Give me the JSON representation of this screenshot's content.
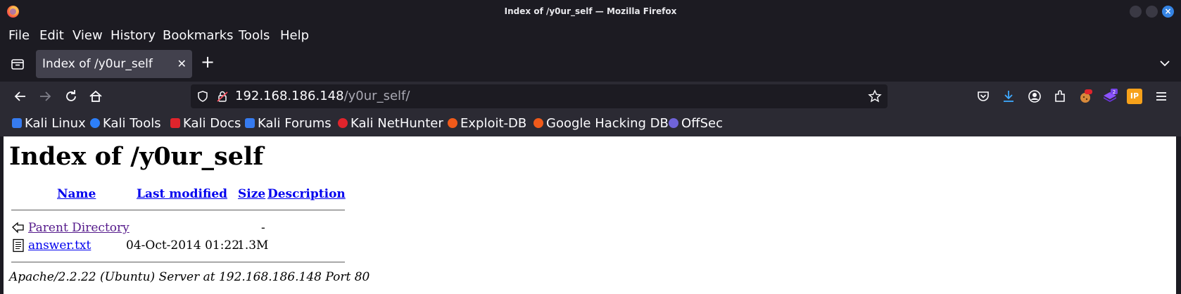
{
  "window": {
    "title": "Index of /y0ur_self — Mozilla Firefox"
  },
  "menu": {
    "items": [
      "File",
      "Edit",
      "View",
      "History",
      "Bookmarks",
      "Tools",
      "Help"
    ]
  },
  "tabs": [
    {
      "label": "Index of /y0ur_self",
      "active": true
    }
  ],
  "urlbar": {
    "host": "192.168.186.148",
    "path": "/y0ur_self/"
  },
  "toolbar": {
    "download_badge": "",
    "extension_badge": "2",
    "ip_label": "IP"
  },
  "bookmarks": [
    {
      "label": "Kali Linux",
      "icon": "kali-dragon-icon",
      "color": "#367bf0"
    },
    {
      "label": "Kali Tools",
      "icon": "kali-tools-icon",
      "color": "#2d7ff9"
    },
    {
      "label": "Kali Docs",
      "icon": "kali-docs-icon",
      "color": "#e0242c"
    },
    {
      "label": "Kali Forums",
      "icon": "kali-forums-icon",
      "color": "#367bf0"
    },
    {
      "label": "Kali NetHunter",
      "icon": "nethunter-icon",
      "color": "#e0242c"
    },
    {
      "label": "Exploit-DB",
      "icon": "exploit-db-icon",
      "color": "#f05a1a"
    },
    {
      "label": "Google Hacking DB",
      "icon": "ghdb-icon",
      "color": "#f05a1a"
    },
    {
      "label": "OffSec",
      "icon": "offsec-icon",
      "color": "#6f63d8"
    }
  ],
  "page": {
    "heading": "Index of /y0ur_self",
    "columns": {
      "name": "Name",
      "modified": "Last modified",
      "size": "Size",
      "description": "Description"
    },
    "rows": [
      {
        "name": "Parent Directory",
        "modified": "",
        "size": "-",
        "description": "",
        "icon": "back-arrow-icon"
      },
      {
        "name": "answer.txt",
        "modified": "04-Oct-2014 01:22",
        "size": "1.3M",
        "description": "",
        "icon": "text-file-icon"
      }
    ],
    "footer": "Apache/2.2.22 (Ubuntu) Server at 192.168.186.148 Port 80"
  }
}
